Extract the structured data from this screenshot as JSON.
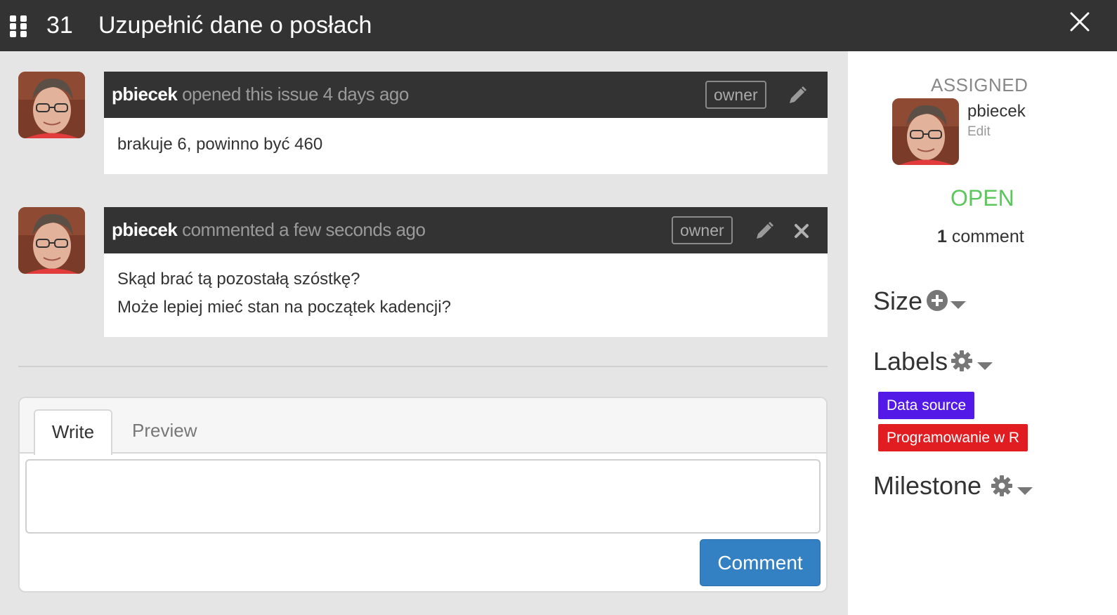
{
  "header": {
    "issue_number": "31",
    "title": "Uzupełnić dane o posłach"
  },
  "comments": [
    {
      "author": "pbiecek",
      "action": "opened this issue 4 days ago",
      "badge": "owner",
      "lines": [
        "brakuje 6, powinno być 460"
      ]
    },
    {
      "author": "pbiecek",
      "action": "commented a few seconds ago",
      "badge": "owner",
      "lines": [
        "Skąd brać tą pozostałą szóstkę?",
        "Może lepiej mieć stan na początek kadencji?"
      ]
    }
  ],
  "editor": {
    "tab_write": "Write",
    "tab_preview": "Preview",
    "textarea_value": "",
    "submit_label": "Comment"
  },
  "sidebar": {
    "assigned_label": "ASSIGNED",
    "assignee": "pbiecek",
    "edit_label": "Edit",
    "status": "OPEN",
    "comment_count": "1",
    "comment_word": "comment",
    "size_label": "Size",
    "labels_label": "Labels",
    "milestone_label": "Milestone",
    "labels": [
      {
        "name": "Data source",
        "color": "#5319e7"
      },
      {
        "name": "Programowanie w R",
        "color": "#e11d21"
      }
    ]
  },
  "colors": {
    "topbar": "#333333",
    "status_open": "#5cc85c",
    "primary_button": "#3380c2"
  },
  "icons": [
    "grid-menu-icon",
    "close-icon",
    "pencil-icon",
    "delete-icon",
    "plus-circle-icon",
    "gear-icon",
    "caret-down-icon"
  ]
}
